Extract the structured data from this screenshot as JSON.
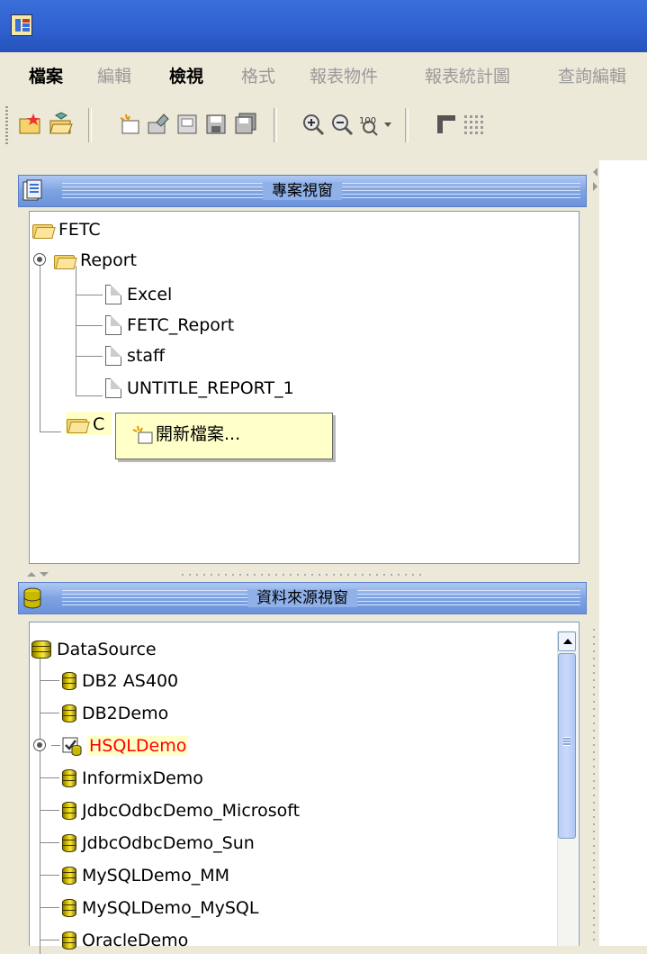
{
  "menu": {
    "items": [
      {
        "label": "檔案",
        "enabled": true
      },
      {
        "label": "編輯",
        "enabled": false
      },
      {
        "label": "檢視",
        "enabled": true
      },
      {
        "label": "格式",
        "enabled": false
      },
      {
        "label": "報表物件",
        "enabled": false
      },
      {
        "label": "報表統計圖",
        "enabled": false
      },
      {
        "label": "查詢編輯",
        "enabled": false
      }
    ]
  },
  "toolbar": {
    "buttons": [
      {
        "icon": "new-folder-icon"
      },
      {
        "icon": "open-folder-icon"
      },
      {
        "icon": "new-report-icon"
      },
      {
        "icon": "open-report-icon"
      },
      {
        "icon": "import-icon"
      },
      {
        "icon": "save-icon"
      },
      {
        "icon": "save-all-icon"
      },
      {
        "icon": "zoom-in-icon"
      },
      {
        "icon": "zoom-out-icon"
      },
      {
        "icon": "zoom-100-icon"
      },
      {
        "icon": "table-layout-icon"
      },
      {
        "icon": "grid-icon"
      }
    ]
  },
  "project_panel": {
    "title": "專案視窗",
    "tree": {
      "root": "FETC",
      "report_folder": "Report",
      "reports": [
        "Excel",
        "FETC_Report",
        "staff",
        "UNTITLE_REPORT_1"
      ],
      "second_folder": "C"
    },
    "context_menu": {
      "new_file": "開新檔案..."
    }
  },
  "datasource_panel": {
    "title": "資料來源視窗",
    "root": "DataSource",
    "items": [
      {
        "label": "DB2 AS400",
        "selected": false
      },
      {
        "label": "DB2Demo",
        "selected": false
      },
      {
        "label": "HSQLDemo",
        "selected": true
      },
      {
        "label": "InformixDemo",
        "selected": false
      },
      {
        "label": "JdbcOdbcDemo_Microsoft",
        "selected": false
      },
      {
        "label": "JdbcOdbcDemo_Sun",
        "selected": false
      },
      {
        "label": "MySQLDemo_MM",
        "selected": false
      },
      {
        "label": "MySQLDemo_MySQL",
        "selected": false
      },
      {
        "label": "OracleDemo",
        "selected": false
      }
    ]
  },
  "colors": {
    "selected_text": "#FF0000",
    "selected_bg": "#FFFFC8",
    "panel_header": "#7EA3E2"
  }
}
